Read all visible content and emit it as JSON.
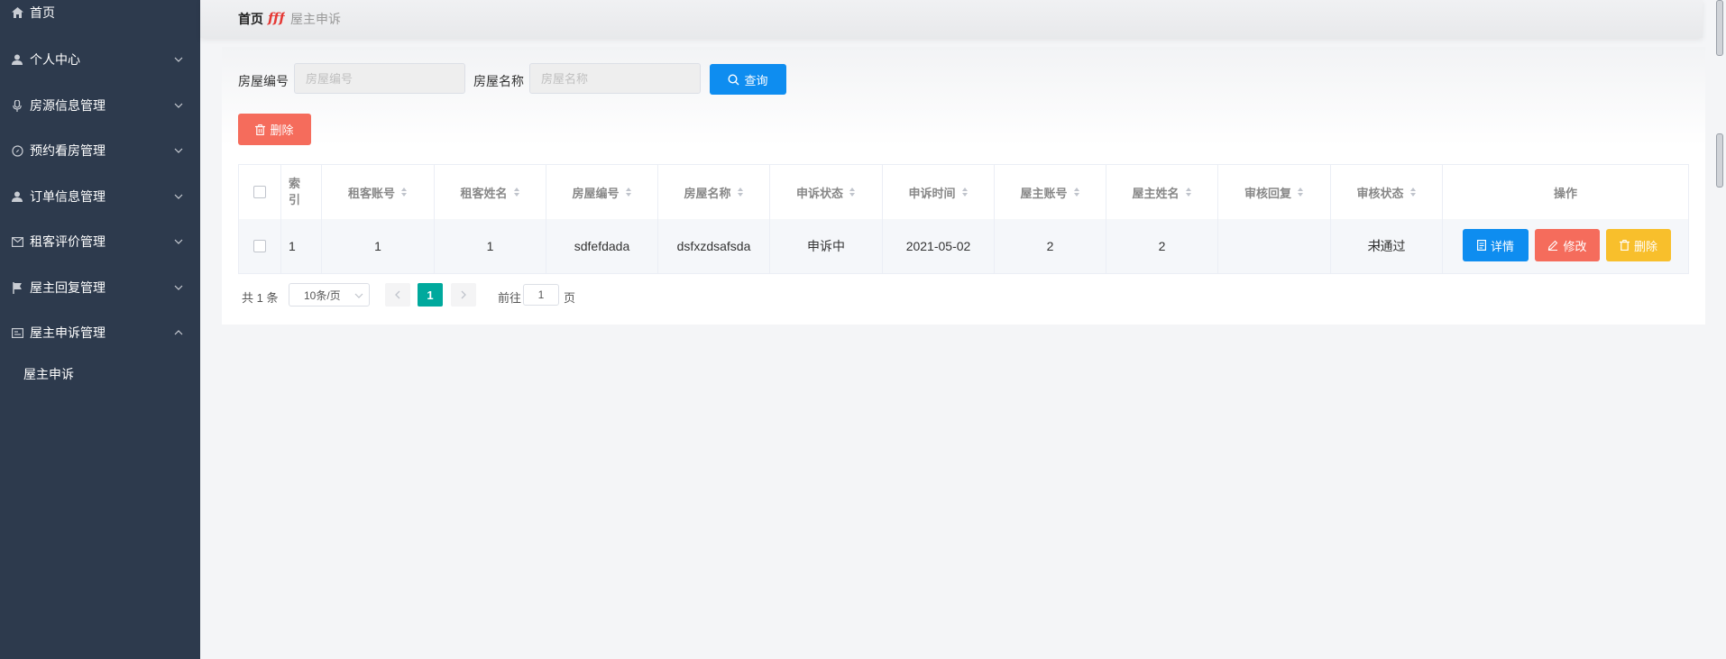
{
  "sidebar": {
    "items": [
      {
        "label": "首页",
        "icon": "home-icon"
      },
      {
        "label": "个人中心",
        "icon": "user-icon"
      },
      {
        "label": "房源信息管理",
        "icon": "microphone-icon"
      },
      {
        "label": "预约看房管理",
        "icon": "compass-icon"
      },
      {
        "label": "订单信息管理",
        "icon": "user-icon"
      },
      {
        "label": "租客评价管理",
        "icon": "mail-icon"
      },
      {
        "label": "屋主回复管理",
        "icon": "flag-icon"
      },
      {
        "label": "屋主申诉管理",
        "icon": "card-icon"
      }
    ],
    "sub_items": [
      {
        "label": "屋主申诉"
      }
    ]
  },
  "breadcrumb": {
    "home": "首页",
    "current": "屋主申诉"
  },
  "search": {
    "house_no_label": "房屋编号",
    "house_no_placeholder": "房屋编号",
    "house_name_label": "房屋名称",
    "house_name_placeholder": "房屋名称",
    "query_label": "查询"
  },
  "toolbar": {
    "delete_label": "删除"
  },
  "table": {
    "headers": {
      "index": "索引",
      "tenant_account": "租客账号",
      "tenant_name": "租客姓名",
      "house_no": "房屋编号",
      "house_name": "房屋名称",
      "appeal_status": "申诉状态",
      "appeal_time": "申诉时间",
      "owner_account": "屋主账号",
      "owner_name": "屋主姓名",
      "review_reply": "审核回复",
      "review_status": "审核状态",
      "actions": "操作"
    },
    "rows": [
      {
        "index": "1",
        "tenant_account": "1",
        "tenant_name": "1",
        "house_no": "sdfefdada",
        "house_name": "dsfxzdsafsda",
        "appeal_status": "申诉中",
        "appeal_time": "2021-05-02",
        "owner_account": "2",
        "owner_name": "2",
        "review_reply": "",
        "review_status": "未通过",
        "detail_label": "详情",
        "edit_label": "修改",
        "delete_label": "删除"
      }
    ]
  },
  "pagination": {
    "total": "共 1 条",
    "page_size": "10条/页",
    "current_page": "1",
    "goto_prefix": "前往",
    "goto_value": "1",
    "goto_suffix": "页"
  },
  "colors": {
    "sidebar_bg": "#2d3a4d",
    "primary": "#0e8df0",
    "danger": "#f56c5c",
    "warning": "#f8bf2c",
    "pager_active": "#00a99d"
  }
}
